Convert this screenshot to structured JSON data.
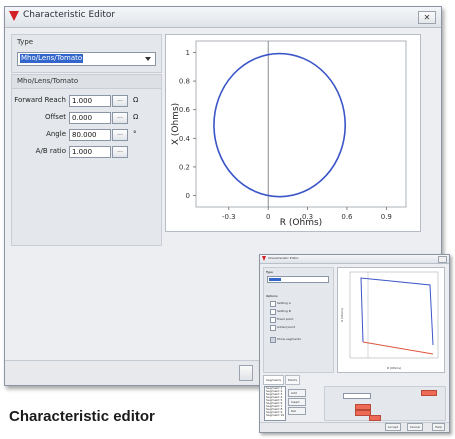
{
  "window": {
    "title": "Characteristic Editor",
    "close_glyph": "✕",
    "type_group_label": "Type",
    "type_value": "Mho/Lens/Tomato",
    "params_group_label": "Mho/Lens/Tomato",
    "params": [
      {
        "label": "Forward Reach",
        "value": "1.000",
        "btn": "...",
        "unit": "Ω"
      },
      {
        "label": "Offset",
        "value": "0.000",
        "btn": "...",
        "unit": "Ω"
      },
      {
        "label": "Angle",
        "value": "80.000",
        "btn": "...",
        "unit": "°"
      },
      {
        "label": "A/B ratio",
        "value": "1.000",
        "btn": "...",
        "unit": ""
      }
    ]
  },
  "chart_data": {
    "type": "scatter",
    "xlabel": "R (Ohms)",
    "ylabel": "X (Ohms)",
    "x_ticks": [
      "-0.3",
      "0",
      "0.3",
      "0.6",
      "0.9"
    ],
    "y_ticks": [
      "0",
      "0.2",
      "0.4",
      "0.6",
      "0.8",
      "1"
    ],
    "xlim": [
      -0.55,
      1.05
    ],
    "ylim": [
      -0.08,
      1.08
    ],
    "grid": false,
    "series": [
      {
        "shape": "circle",
        "center": [
          0.0868,
          0.4924
        ],
        "radius": 0.5,
        "color": "#3a55c7"
      }
    ]
  },
  "inset": {
    "title": "Characteristic Editor",
    "type_label": "Type",
    "options_label": "Options",
    "checkboxes": [
      "Setting A",
      "Setting B",
      "Fixed point",
      "Added point",
      "Show segments"
    ],
    "tabs": [
      "Segments",
      "Points"
    ],
    "list_items": [
      "Segment 1",
      "Segment 2",
      "Segment 3",
      "Segment 4",
      "Segment 5",
      "Segment 6",
      "Segment 7",
      "Segment 8",
      "Segment 9",
      "Segment 10"
    ],
    "side_buttons": [
      "Add",
      "Insert",
      "Del"
    ],
    "footer_buttons": [
      "Accept",
      "Cancel",
      "Help"
    ],
    "xlabel": "R (Ohms)",
    "ylabel": "X (Ohms)",
    "colors": {
      "top_edge": "#3a55c7",
      "bottom_edge": "#e0523c"
    }
  },
  "caption": "Characteristic editor"
}
